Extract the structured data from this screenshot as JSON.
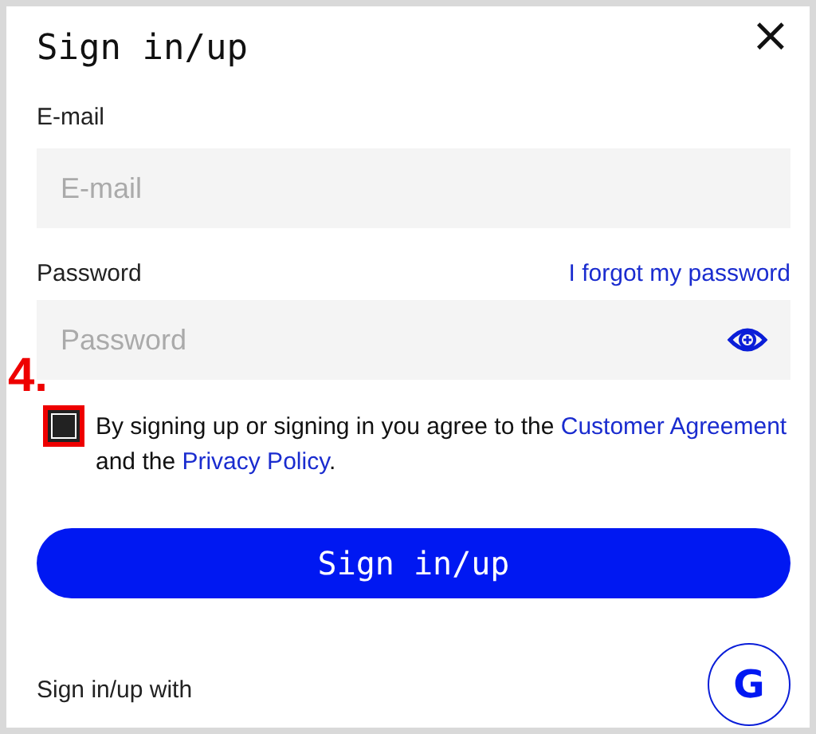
{
  "dialog": {
    "title": "Sign in/up",
    "close_label": "×"
  },
  "email": {
    "label": "E-mail",
    "placeholder": "E-mail"
  },
  "password": {
    "label": "Password",
    "forgot_link": "I forgot my password",
    "placeholder": "Password"
  },
  "agreement": {
    "checked": true,
    "text_before": "By signing up or signing in you agree to the",
    "link_1": "Customer Agreement",
    "text_middle": "and the",
    "link_2": "Privacy Policy",
    "text_after": "."
  },
  "annotation": {
    "label": "4."
  },
  "submit_button": "Sign in/up",
  "social": {
    "label": "Sign in/up with",
    "google_button": "G"
  }
}
